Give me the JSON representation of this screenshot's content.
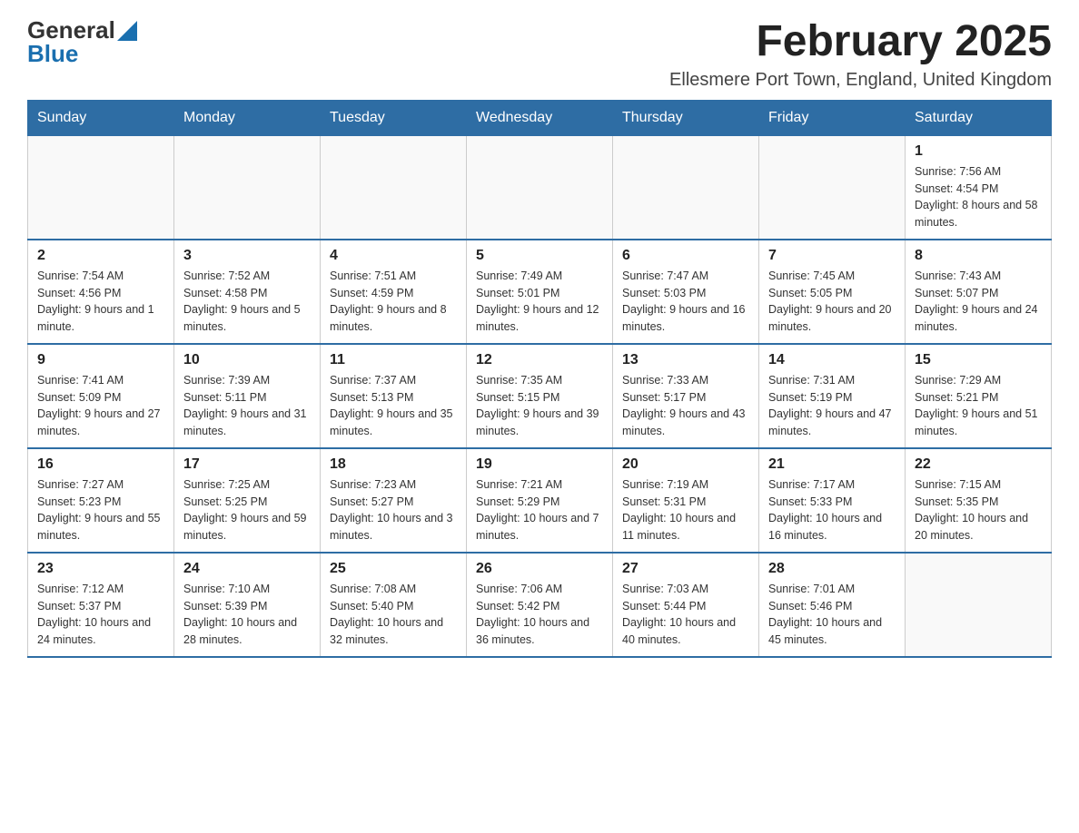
{
  "logo": {
    "general": "General",
    "blue": "Blue"
  },
  "title": "February 2025",
  "location": "Ellesmere Port Town, England, United Kingdom",
  "weekdays": [
    "Sunday",
    "Monday",
    "Tuesday",
    "Wednesday",
    "Thursday",
    "Friday",
    "Saturday"
  ],
  "weeks": [
    [
      {
        "day": "",
        "info": ""
      },
      {
        "day": "",
        "info": ""
      },
      {
        "day": "",
        "info": ""
      },
      {
        "day": "",
        "info": ""
      },
      {
        "day": "",
        "info": ""
      },
      {
        "day": "",
        "info": ""
      },
      {
        "day": "1",
        "info": "Sunrise: 7:56 AM\nSunset: 4:54 PM\nDaylight: 8 hours and 58 minutes."
      }
    ],
    [
      {
        "day": "2",
        "info": "Sunrise: 7:54 AM\nSunset: 4:56 PM\nDaylight: 9 hours and 1 minute."
      },
      {
        "day": "3",
        "info": "Sunrise: 7:52 AM\nSunset: 4:58 PM\nDaylight: 9 hours and 5 minutes."
      },
      {
        "day": "4",
        "info": "Sunrise: 7:51 AM\nSunset: 4:59 PM\nDaylight: 9 hours and 8 minutes."
      },
      {
        "day": "5",
        "info": "Sunrise: 7:49 AM\nSunset: 5:01 PM\nDaylight: 9 hours and 12 minutes."
      },
      {
        "day": "6",
        "info": "Sunrise: 7:47 AM\nSunset: 5:03 PM\nDaylight: 9 hours and 16 minutes."
      },
      {
        "day": "7",
        "info": "Sunrise: 7:45 AM\nSunset: 5:05 PM\nDaylight: 9 hours and 20 minutes."
      },
      {
        "day": "8",
        "info": "Sunrise: 7:43 AM\nSunset: 5:07 PM\nDaylight: 9 hours and 24 minutes."
      }
    ],
    [
      {
        "day": "9",
        "info": "Sunrise: 7:41 AM\nSunset: 5:09 PM\nDaylight: 9 hours and 27 minutes."
      },
      {
        "day": "10",
        "info": "Sunrise: 7:39 AM\nSunset: 5:11 PM\nDaylight: 9 hours and 31 minutes."
      },
      {
        "day": "11",
        "info": "Sunrise: 7:37 AM\nSunset: 5:13 PM\nDaylight: 9 hours and 35 minutes."
      },
      {
        "day": "12",
        "info": "Sunrise: 7:35 AM\nSunset: 5:15 PM\nDaylight: 9 hours and 39 minutes."
      },
      {
        "day": "13",
        "info": "Sunrise: 7:33 AM\nSunset: 5:17 PM\nDaylight: 9 hours and 43 minutes."
      },
      {
        "day": "14",
        "info": "Sunrise: 7:31 AM\nSunset: 5:19 PM\nDaylight: 9 hours and 47 minutes."
      },
      {
        "day": "15",
        "info": "Sunrise: 7:29 AM\nSunset: 5:21 PM\nDaylight: 9 hours and 51 minutes."
      }
    ],
    [
      {
        "day": "16",
        "info": "Sunrise: 7:27 AM\nSunset: 5:23 PM\nDaylight: 9 hours and 55 minutes."
      },
      {
        "day": "17",
        "info": "Sunrise: 7:25 AM\nSunset: 5:25 PM\nDaylight: 9 hours and 59 minutes."
      },
      {
        "day": "18",
        "info": "Sunrise: 7:23 AM\nSunset: 5:27 PM\nDaylight: 10 hours and 3 minutes."
      },
      {
        "day": "19",
        "info": "Sunrise: 7:21 AM\nSunset: 5:29 PM\nDaylight: 10 hours and 7 minutes."
      },
      {
        "day": "20",
        "info": "Sunrise: 7:19 AM\nSunset: 5:31 PM\nDaylight: 10 hours and 11 minutes."
      },
      {
        "day": "21",
        "info": "Sunrise: 7:17 AM\nSunset: 5:33 PM\nDaylight: 10 hours and 16 minutes."
      },
      {
        "day": "22",
        "info": "Sunrise: 7:15 AM\nSunset: 5:35 PM\nDaylight: 10 hours and 20 minutes."
      }
    ],
    [
      {
        "day": "23",
        "info": "Sunrise: 7:12 AM\nSunset: 5:37 PM\nDaylight: 10 hours and 24 minutes."
      },
      {
        "day": "24",
        "info": "Sunrise: 7:10 AM\nSunset: 5:39 PM\nDaylight: 10 hours and 28 minutes."
      },
      {
        "day": "25",
        "info": "Sunrise: 7:08 AM\nSunset: 5:40 PM\nDaylight: 10 hours and 32 minutes."
      },
      {
        "day": "26",
        "info": "Sunrise: 7:06 AM\nSunset: 5:42 PM\nDaylight: 10 hours and 36 minutes."
      },
      {
        "day": "27",
        "info": "Sunrise: 7:03 AM\nSunset: 5:44 PM\nDaylight: 10 hours and 40 minutes."
      },
      {
        "day": "28",
        "info": "Sunrise: 7:01 AM\nSunset: 5:46 PM\nDaylight: 10 hours and 45 minutes."
      },
      {
        "day": "",
        "info": ""
      }
    ]
  ]
}
